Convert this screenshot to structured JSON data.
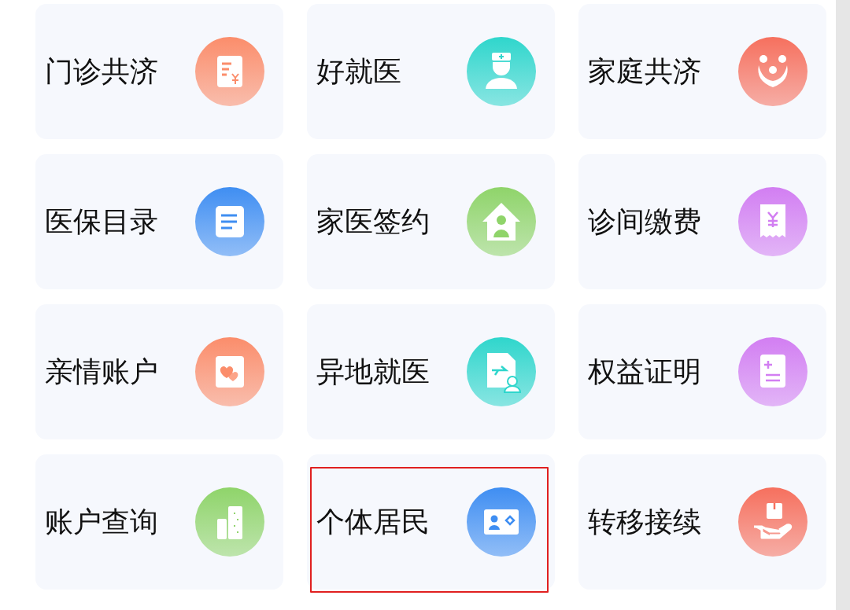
{
  "tiles": [
    {
      "label": "门诊共济",
      "kind": "bill",
      "color": "#fb8d6b",
      "highlighted": false
    },
    {
      "label": "好就医",
      "kind": "doctor",
      "color": "#2fd6cc",
      "highlighted": false
    },
    {
      "label": "家庭共济",
      "kind": "family",
      "color": "#f6705e",
      "highlighted": false
    },
    {
      "label": "医保目录",
      "kind": "list",
      "color": "#3f8ef2",
      "highlighted": false
    },
    {
      "label": "家医签约",
      "kind": "house",
      "color": "#8fd46a",
      "highlighted": false
    },
    {
      "label": "诊间缴费",
      "kind": "receipt",
      "color": "#d27ef2",
      "highlighted": false
    },
    {
      "label": "亲情账户",
      "kind": "hearts",
      "color": "#fb8d6b",
      "highlighted": false
    },
    {
      "label": "异地就医",
      "kind": "travel",
      "color": "#2fd6cc",
      "highlighted": false
    },
    {
      "label": "权益证明",
      "kind": "certificate",
      "color": "#d27ef2",
      "highlighted": false
    },
    {
      "label": "账户查询",
      "kind": "buildings",
      "color": "#8fd46a",
      "highlighted": false
    },
    {
      "label": "个体居民",
      "kind": "card",
      "color": "#3f8ef2",
      "highlighted": true
    },
    {
      "label": "转移接续",
      "kind": "parcel",
      "color": "#f6705e",
      "highlighted": false
    }
  ]
}
